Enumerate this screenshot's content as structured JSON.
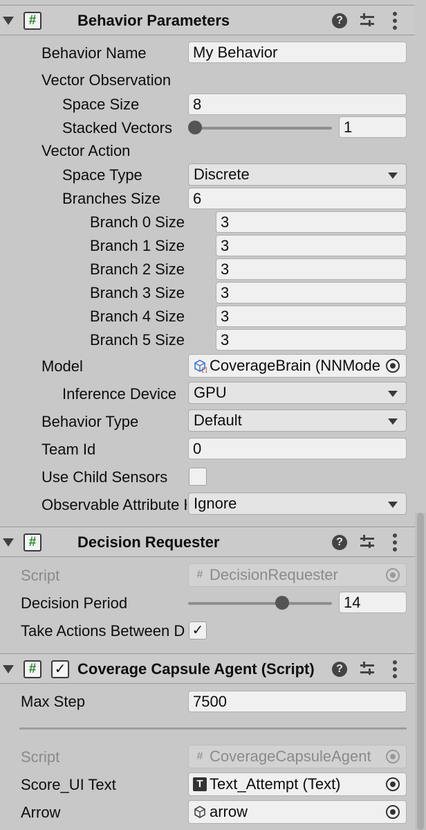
{
  "behavior_parameters": {
    "title": "Behavior Parameters",
    "behavior_name_label": "Behavior Name",
    "behavior_name_value": "My Behavior",
    "vector_observation_label": "Vector Observation",
    "space_size_label": "Space Size",
    "space_size_value": "8",
    "stacked_vectors_label": "Stacked Vectors",
    "stacked_vectors_value": "1",
    "stacked_vectors_level": 0,
    "vector_action_label": "Vector Action",
    "space_type_label": "Space Type",
    "space_type_value": "Discrete",
    "branches_size_label": "Branches Size",
    "branches_size_value": "6",
    "branches": [
      {
        "label": "Branch 0 Size",
        "value": "3"
      },
      {
        "label": "Branch 1 Size",
        "value": "3"
      },
      {
        "label": "Branch 2 Size",
        "value": "3"
      },
      {
        "label": "Branch 3 Size",
        "value": "3"
      },
      {
        "label": "Branch 4 Size",
        "value": "3"
      },
      {
        "label": "Branch 5 Size",
        "value": "3"
      }
    ],
    "model_label": "Model",
    "model_value": "CoverageBrain (NNModel)",
    "inference_device_label": "Inference Device",
    "inference_device_value": "GPU",
    "behavior_type_label": "Behavior Type",
    "behavior_type_value": "Default",
    "team_id_label": "Team Id",
    "team_id_value": "0",
    "use_child_sensors_label": "Use Child Sensors",
    "use_child_sensors_checked": false,
    "observable_attribute_label": "Observable Attribute Handling",
    "observable_attribute_value": "Ignore"
  },
  "decision_requester": {
    "title": "Decision Requester",
    "script_label": "Script",
    "script_value": "DecisionRequester",
    "decision_period_label": "Decision Period",
    "decision_period_value": "14",
    "decision_period_level": 0.67,
    "take_actions_label": "Take Actions Between Decisions",
    "take_actions_checked": true
  },
  "coverage_agent": {
    "title": "Coverage Capsule Agent (Script)",
    "enabled": true,
    "max_step_label": "Max Step",
    "max_step_value": "7500",
    "script_label": "Script",
    "script_value": "CoverageCapsuleAgent",
    "score_ui_label": "Score_UI Text",
    "score_ui_value": "Text_Attempt (Text)",
    "arrow_label": "Arrow",
    "arrow_value": "arrow"
  },
  "icons": {
    "hash": "#",
    "check": "✓",
    "help": "?"
  }
}
